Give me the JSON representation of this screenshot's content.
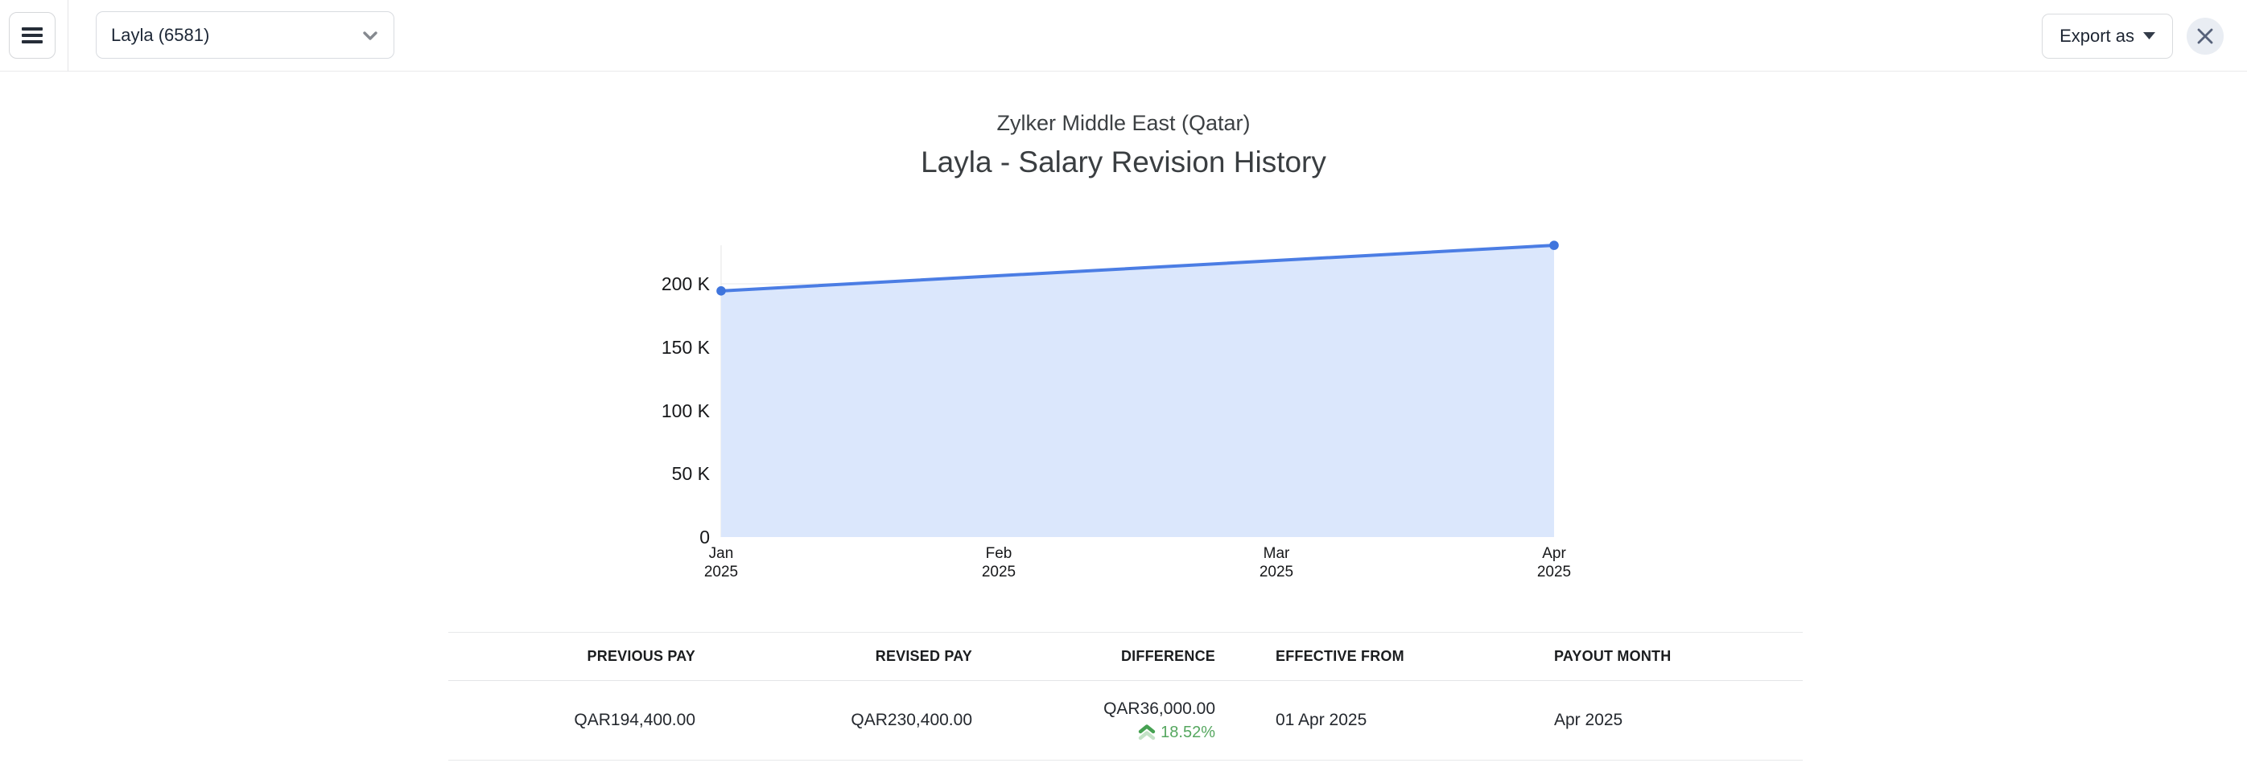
{
  "topbar": {
    "employee_selector_value": "Layla (6581)",
    "export_label": "Export as"
  },
  "chart_data": {
    "type": "area",
    "title": "Layla - Salary Revision History",
    "subtitle": "Zylker Middle East (Qatar)",
    "x": [
      "Jan 2025",
      "Apr 2025"
    ],
    "series": [
      {
        "name": "Salary",
        "values": [
          194400,
          230400
        ]
      }
    ],
    "x_tick_labels": [
      [
        "Jan",
        "2025"
      ],
      [
        "Feb",
        "2025"
      ],
      [
        "Mar",
        "2025"
      ],
      [
        "Apr",
        "2025"
      ]
    ],
    "y_tick_labels": [
      "0",
      "50 K",
      "100 K",
      "150 K",
      "200 K"
    ],
    "y_tick_values": [
      0,
      50000,
      100000,
      150000,
      200000
    ],
    "ylim": [
      0,
      230400
    ],
    "grid": true,
    "legend": "none",
    "colors": {
      "line": "#4b7de4",
      "fill": "#dbe7fc",
      "marker": "#3f75dd"
    }
  },
  "table": {
    "headers": [
      "PREVIOUS PAY",
      "REVISED PAY",
      "DIFFERENCE",
      "EFFECTIVE FROM",
      "PAYOUT MONTH"
    ],
    "rows": [
      {
        "previous_pay": "QAR194,400.00",
        "revised_pay": "QAR230,400.00",
        "difference": "QAR36,000.00",
        "difference_change": "18.52%",
        "difference_direction": "up",
        "effective_from": "01 Apr 2025",
        "payout_month": "Apr 2025"
      }
    ]
  },
  "colors": {
    "accent_blue": "#4b7de4",
    "area_fill": "#dbe7fc",
    "positive_green": "#55a75f",
    "divider_gray": "#e7e8ea"
  }
}
